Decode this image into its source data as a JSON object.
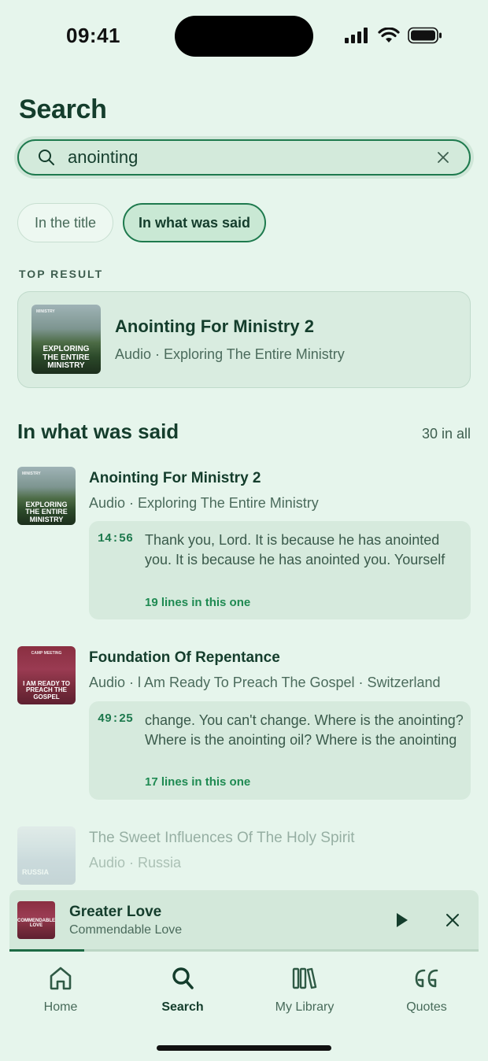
{
  "status": {
    "time": "09:41"
  },
  "page": {
    "title": "Search"
  },
  "search": {
    "value": "anointing",
    "placeholder": ""
  },
  "filters": {
    "in_title": "In the title",
    "in_said": "In what was said",
    "active": "In what was said"
  },
  "top_result": {
    "section_label": "TOP RESULT",
    "title": "Anointing For Ministry 2",
    "subtitle": "Audio · Exploring The Entire Ministry",
    "thumb": {
      "text": "EXPLORING THE ENTIRE MINISTRY",
      "top_text": "MINISTRY"
    }
  },
  "results_section": {
    "heading": "In what was said",
    "count": "30 in all"
  },
  "results": [
    {
      "title": "Anointing For Ministry 2",
      "subtitle": "Audio · Exploring The Entire Ministry",
      "thumb": {
        "text": "EXPLORING THE ENTIRE MINISTRY",
        "top_text": "MINISTRY"
      },
      "timestamp": "14:56",
      "snippet": "Thank you, Lord. It is because he has anointed you. It is because he has anointed you. Yourself",
      "lines": "19 lines in this one"
    },
    {
      "title": "Foundation Of Repentance",
      "subtitle": "Audio · l Am Ready To Preach The Gospel · Switzerland",
      "thumb": {
        "text": "I AM READY TO PREACH THE GOSPEL",
        "top_text": "CAMP MEETING"
      },
      "timestamp": "49:25",
      "snippet": "change. You can't change. Where is the anointing? Where is the anointing oil? Where is the anointing",
      "lines": "17 lines in this one"
    },
    {
      "title": "The Sweet Influences Of The Holy Spirit",
      "subtitle": "Audio · Russia",
      "thumb": {
        "text": "RUSSIA"
      }
    }
  ],
  "mini_player": {
    "title": "Greater Love",
    "subtitle": "Commendable Love",
    "thumb": {
      "text": "COMMENDABLE LOVE"
    },
    "progress": 0.16
  },
  "tabs": [
    {
      "label": "Home",
      "icon": "home-icon"
    },
    {
      "label": "Search",
      "icon": "search-icon"
    },
    {
      "label": "My Library",
      "icon": "library-icon"
    },
    {
      "label": "Quotes",
      "icon": "quotes-icon"
    }
  ],
  "colors": {
    "accent": "#1e7a4e",
    "background": "#e6f5ec",
    "text": "#143d2c"
  }
}
